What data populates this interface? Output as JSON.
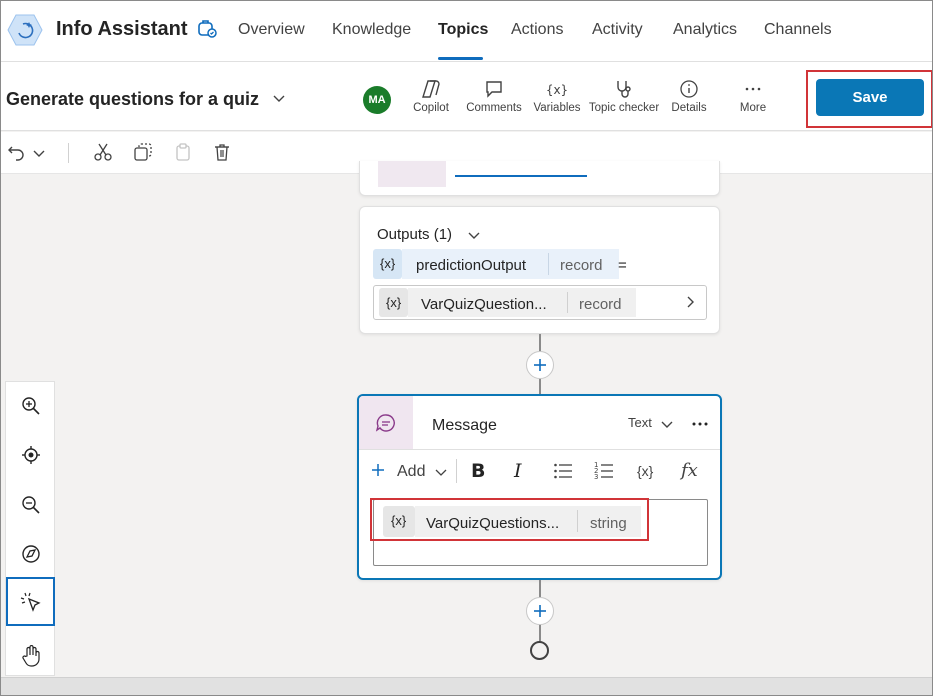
{
  "app": {
    "title": "Info Assistant",
    "tabs": [
      {
        "label": "Overview"
      },
      {
        "label": "Knowledge"
      },
      {
        "label": "Topics"
      },
      {
        "label": "Actions"
      },
      {
        "label": "Activity"
      },
      {
        "label": "Analytics"
      },
      {
        "label": "Channels"
      }
    ],
    "active_tab": "Topics"
  },
  "toolbar": {
    "topic_name": "Generate questions for a quiz",
    "avatar_initials": "MA",
    "tools": [
      {
        "label": "Copilot",
        "icon": "copilot-icon"
      },
      {
        "label": "Comments",
        "icon": "comment-icon"
      },
      {
        "label": "Variables",
        "icon": "variable-icon"
      },
      {
        "label": "Topic checker",
        "icon": "stethoscope-icon"
      },
      {
        "label": "Details",
        "icon": "info-icon"
      },
      {
        "label": "More",
        "icon": "more-icon"
      }
    ],
    "save_label": "Save"
  },
  "outputs_node": {
    "header": "Outputs (1)",
    "output_var_icon": "{x}",
    "output_var_name": "predictionOutput",
    "output_var_type": "record",
    "equals": "=",
    "assign_icon": "{x}",
    "assign_name": "VarQuizQuestion...",
    "assign_type": "record"
  },
  "message_node": {
    "title": "Message",
    "mode": "Text",
    "add_label": "Add",
    "format_bold": "B",
    "format_italic": "I",
    "var_icon": "{x}",
    "fx_icon": "fx",
    "content_var_icon": "{x}",
    "content_var_name": "VarQuizQuestions...",
    "content_var_type": "string"
  },
  "colors": {
    "accent": "#0f6cbd",
    "save": "#0a77b6",
    "highlight": "#d13438",
    "avatar": "#1a7c2a"
  }
}
